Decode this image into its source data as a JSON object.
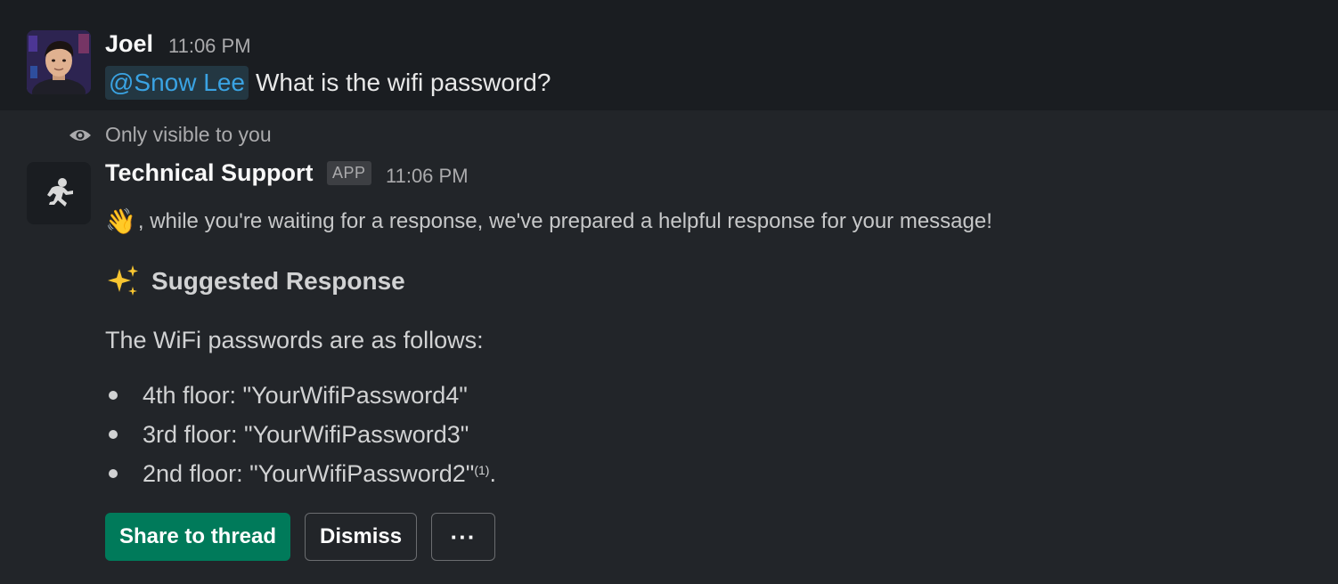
{
  "message1": {
    "author": "Joel",
    "time": "11:06 PM",
    "mention": "@Snow Lee",
    "text": "What is the wifi password?"
  },
  "message2": {
    "visibility": "Only visible to you",
    "author": "Technical Support",
    "badge": "APP",
    "time": "11:06 PM",
    "intro_emoji": "👋",
    "intro_text": ", while you're waiting for a response, we've prepared a helpful response for your message!",
    "suggested_title": "Suggested Response",
    "paragraph": "The WiFi passwords are as follows:",
    "list": [
      {
        "text": "4th floor: \"YourWifiPassword4\""
      },
      {
        "text": "3rd floor: \"YourWifiPassword3\""
      },
      {
        "text": "2nd floor: \"YourWifiPassword2\"",
        "citation": "(1)",
        "suffix": "."
      }
    ],
    "buttons": {
      "share": "Share to thread",
      "dismiss": "Dismiss",
      "more": "···"
    }
  },
  "colors": {
    "background": "#1a1d21",
    "highlight_background": "#222529",
    "mention": "#3aa3e3",
    "primary_button": "#007a5a"
  },
  "icons": {
    "visibility": "eye-icon",
    "sparkles": "sparkles-icon",
    "bot_avatar": "running-figure-icon"
  }
}
